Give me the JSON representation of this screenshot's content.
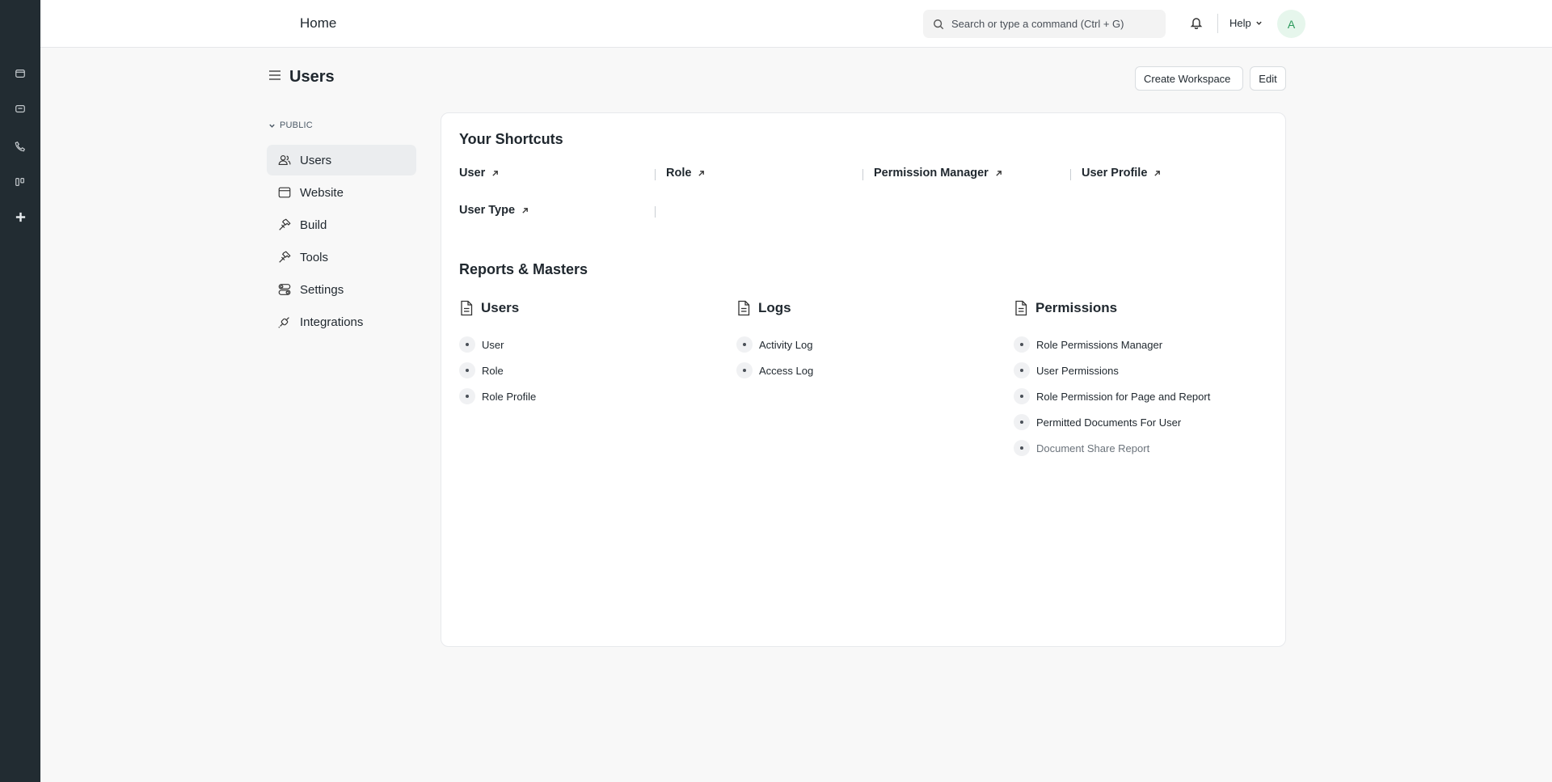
{
  "navbar": {
    "home": "Home",
    "search_placeholder": "Search or type a command (Ctrl + G)",
    "help": "Help",
    "avatar_initial": "A"
  },
  "page": {
    "title": "Users",
    "create_workspace": "Create Workspace",
    "edit": "Edit"
  },
  "sidebar": {
    "section": "PUBLIC",
    "items": [
      {
        "label": "Users",
        "icon": "users-icon",
        "active": true
      },
      {
        "label": "Website",
        "icon": "website-icon"
      },
      {
        "label": "Build",
        "icon": "build-icon"
      },
      {
        "label": "Tools",
        "icon": "tools-icon"
      },
      {
        "label": "Settings",
        "icon": "settings-icon"
      },
      {
        "label": "Integrations",
        "icon": "integrations-icon"
      }
    ]
  },
  "shortcuts": {
    "title": "Your Shortcuts",
    "items": [
      "User",
      "Role",
      "Permission Manager",
      "User Profile",
      "User Type"
    ]
  },
  "reports": {
    "title": "Reports & Masters",
    "columns": [
      {
        "title": "Users",
        "links": [
          "User",
          "Role",
          "Role Profile"
        ]
      },
      {
        "title": "Logs",
        "links": [
          "Activity Log",
          "Access Log"
        ]
      },
      {
        "title": "Permissions",
        "links": [
          "Role Permissions Manager",
          "User Permissions",
          "Role Permission for Page and Report",
          "Permitted Documents For User",
          "Document Share Report"
        ]
      }
    ]
  },
  "colors": {
    "rail": "#222c32",
    "active_item": "#ebedef",
    "avatar_bg": "#e6f6ec",
    "avatar_text": "#2b9a5b"
  }
}
